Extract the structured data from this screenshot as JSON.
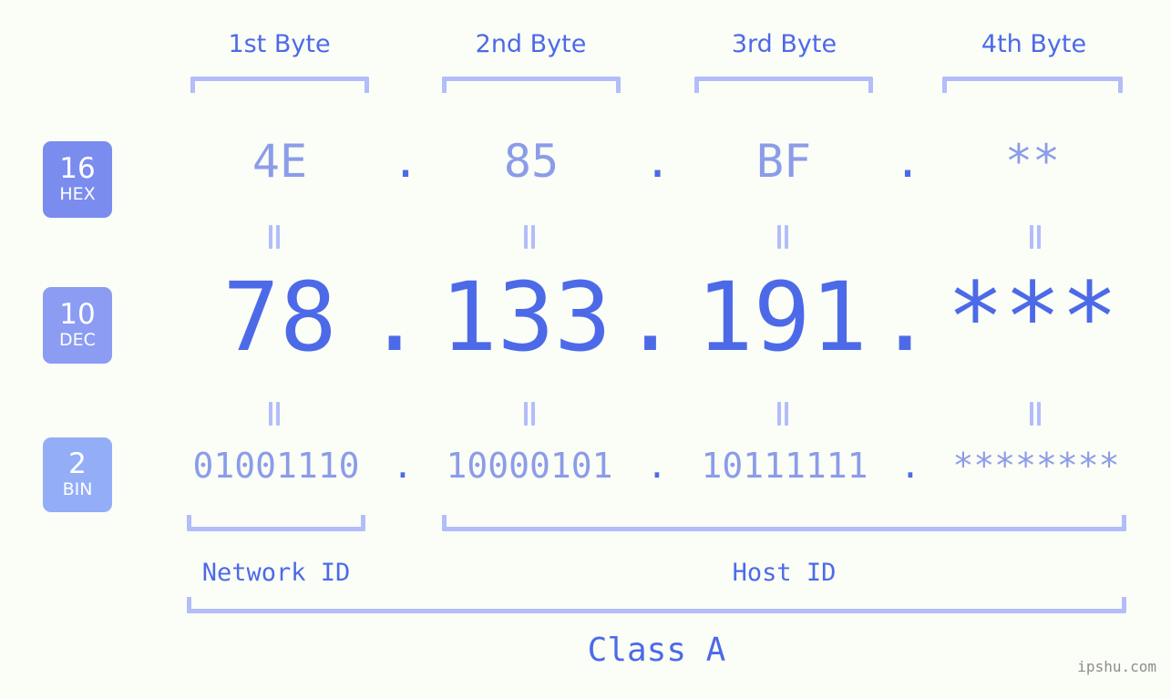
{
  "background_color": "#fbfdf7",
  "colors": {
    "accent_strong": "#4c6ae8",
    "accent_light": "#8b9ce8",
    "bracket": "#b3bdfa",
    "badge_hex": "#7b8cef",
    "badge_dec": "#8b9cf2",
    "badge_bin": "#93aef7",
    "watermark": "#8d8d8d"
  },
  "headers": [
    {
      "label": "1st Byte"
    },
    {
      "label": "2nd Byte"
    },
    {
      "label": "3rd Byte"
    },
    {
      "label": "4th Byte"
    }
  ],
  "bases": [
    {
      "number": "16",
      "name": "HEX"
    },
    {
      "number": "10",
      "name": "DEC"
    },
    {
      "number": "2",
      "name": "BIN"
    }
  ],
  "rows": {
    "hex": {
      "base_number": "16",
      "base_name": "HEX",
      "values": [
        "4E",
        "85",
        "BF",
        "**"
      ],
      "separator": "."
    },
    "dec": {
      "base_number": "10",
      "base_name": "DEC",
      "values": [
        "78",
        "133",
        "191",
        "***"
      ],
      "separator": "."
    },
    "bin": {
      "base_number": "2",
      "base_name": "BIN",
      "values": [
        "01001110",
        "10000101",
        "10111111",
        "********"
      ],
      "separator": "."
    }
  },
  "separators": {
    "hex": [
      ".",
      ".",
      "."
    ],
    "dec": [
      ".",
      ".",
      "."
    ],
    "bin": [
      ".",
      ".",
      "."
    ]
  },
  "equivalence_marks": {
    "symbol": "||",
    "count_per_gap": 4,
    "gaps": 2
  },
  "segments": {
    "network_id": "Network ID",
    "host_id": "Host ID",
    "class": "Class A"
  },
  "watermark": "ipshu.com"
}
